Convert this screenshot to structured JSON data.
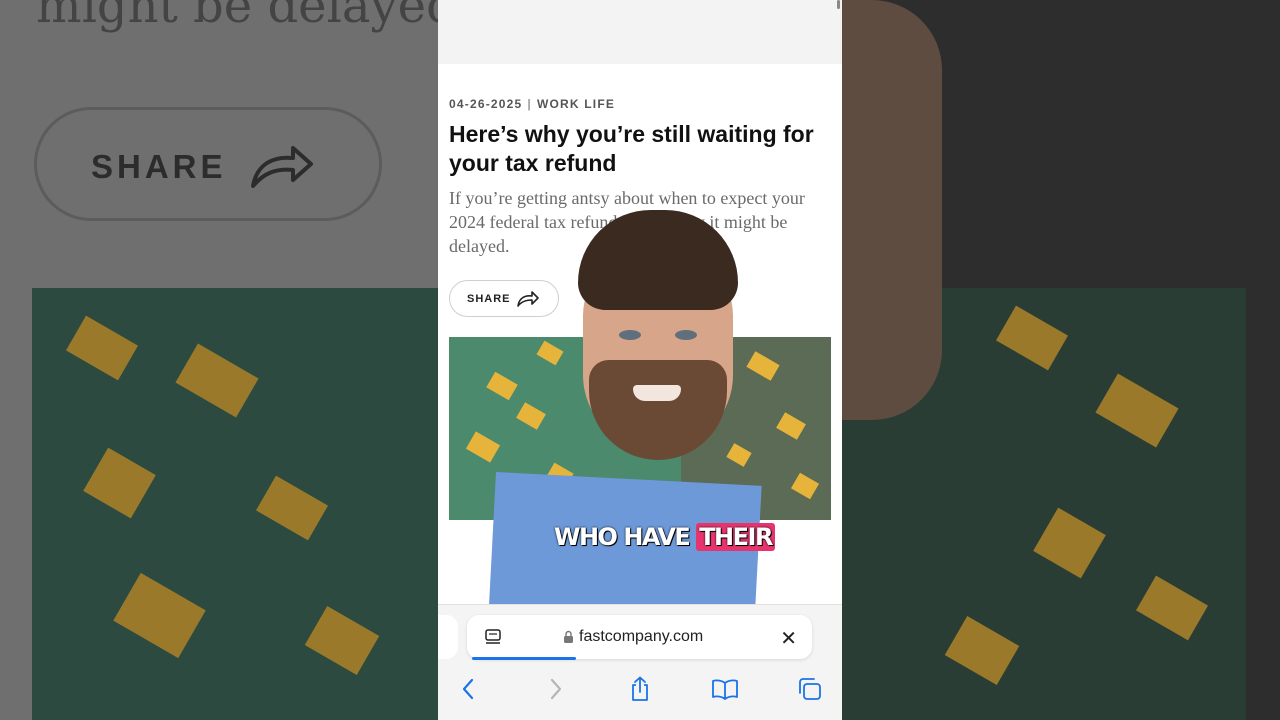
{
  "background": {
    "left_text": "might be delayed",
    "left_share_label": "SHARE"
  },
  "article": {
    "date": "04-26-2025",
    "section": "WORK LIFE",
    "headline": "Here’s why you’re still waiting for your tax refund",
    "dek": "If you’re getting antsy about when to expect your 2024 federal tax refund, here’s why it might be delayed.",
    "share_label": "SHARE"
  },
  "video_caption": {
    "text": "WHO HAVE",
    "highlight": "THEIR",
    "highlight_color": "#e8346e"
  },
  "browser": {
    "url": "fastcompany.com",
    "load_progress": 0.3,
    "accent_color": "#1a73e8",
    "toolbar": {
      "back_icon": "chevron-left-icon",
      "forward_icon": "chevron-right-icon",
      "share_icon": "share-icon",
      "bookmarks_icon": "book-icon",
      "tabs_icon": "tabs-icon"
    }
  }
}
